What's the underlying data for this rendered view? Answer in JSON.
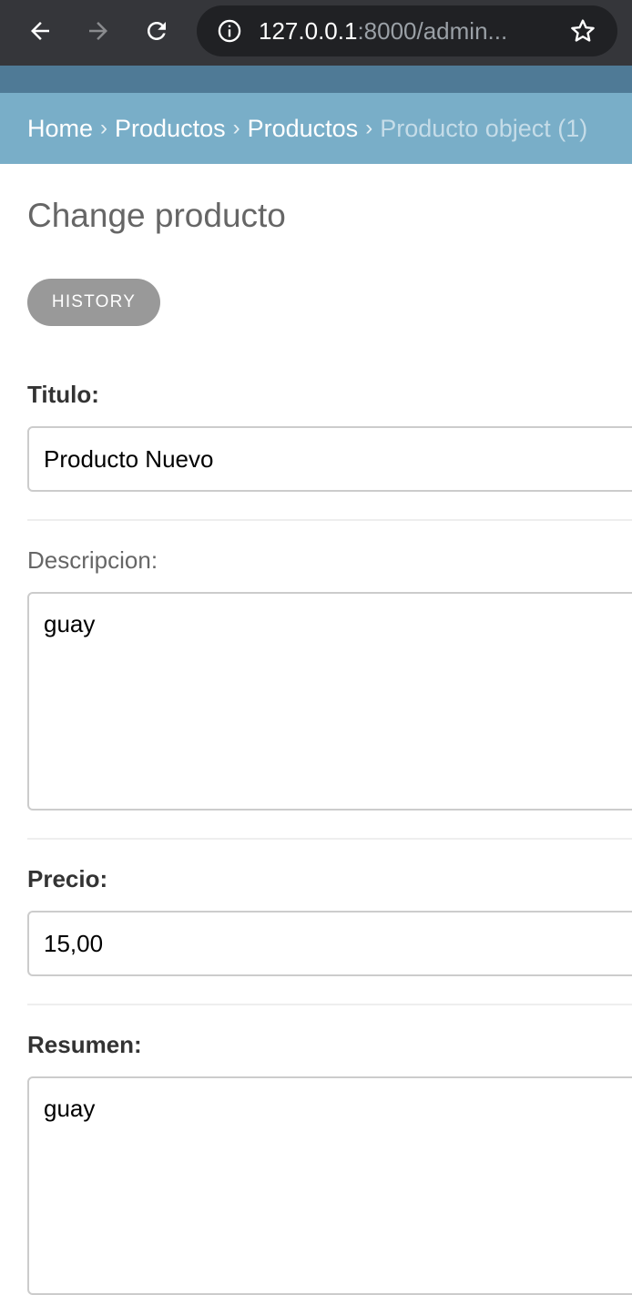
{
  "browser": {
    "url_host": "127.0.0.1",
    "url_rest": ":8000/admin...",
    "icons": [
      "back-arrow-icon",
      "forward-arrow-icon",
      "reload-icon",
      "info-icon",
      "star-icon"
    ]
  },
  "breadcrumbs": {
    "home": "Home",
    "sep": "›",
    "app": "Productos",
    "model": "Productos",
    "current": "Producto object (1)"
  },
  "page": {
    "title": "Change producto",
    "history_label": "HISTORY"
  },
  "fields": {
    "titulo": {
      "label": "Titulo:",
      "value": "Producto Nuevo"
    },
    "descripcion": {
      "label": "Descripcion:",
      "value": "guay"
    },
    "precio": {
      "label": "Precio:",
      "value": "15,00"
    },
    "resumen": {
      "label": "Resumen:",
      "value": "guay"
    }
  },
  "colors": {
    "browser_chrome": "#35363a",
    "address_bar": "#202124",
    "header": "#4f7a96",
    "breadcrumbs": "#79aec8",
    "history_button": "#999999"
  }
}
